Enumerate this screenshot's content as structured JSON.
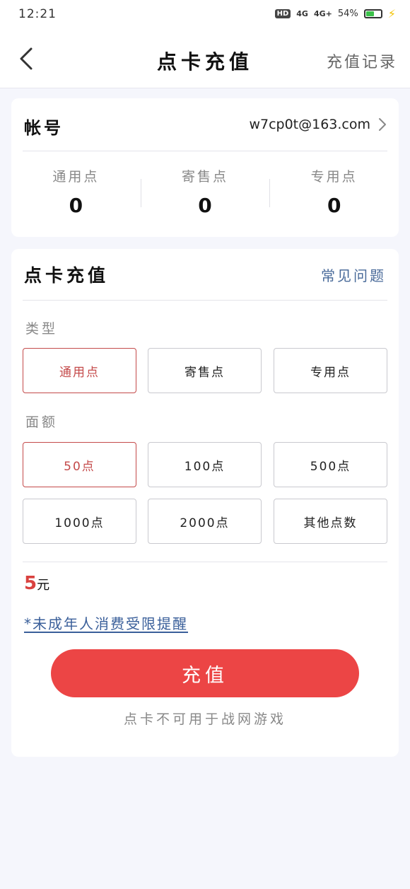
{
  "status_bar": {
    "time": "12:21",
    "hd": "HD",
    "signal1": "4G",
    "signal2": "4G+",
    "battery": "54%",
    "battery_level": 0.54
  },
  "nav": {
    "title": "点卡充值",
    "right_link": "充值记录"
  },
  "account": {
    "label": "帐号",
    "value": "w7cp0t@163.com",
    "points": [
      {
        "label": "通用点",
        "value": "0"
      },
      {
        "label": "寄售点",
        "value": "0"
      },
      {
        "label": "专用点",
        "value": "0"
      }
    ]
  },
  "recharge": {
    "title": "点卡充值",
    "faq": "常见问题",
    "type_label": "类型",
    "types": [
      "通用点",
      "寄售点",
      "专用点"
    ],
    "selected_type": "通用点",
    "amount_label": "面额",
    "amounts": [
      "50点",
      "100点",
      "500点",
      "1000点",
      "2000点",
      "其他点数"
    ],
    "selected_amount": "50点",
    "price_number": "5",
    "price_unit": "元",
    "notice": "*未成年人消费受限提醒",
    "submit": "充值",
    "footnote": "点卡不可用于战网游戏"
  },
  "colors": {
    "accent": "#ec4545",
    "selected_border": "#c44a4a",
    "link": "#3a5f9a"
  }
}
